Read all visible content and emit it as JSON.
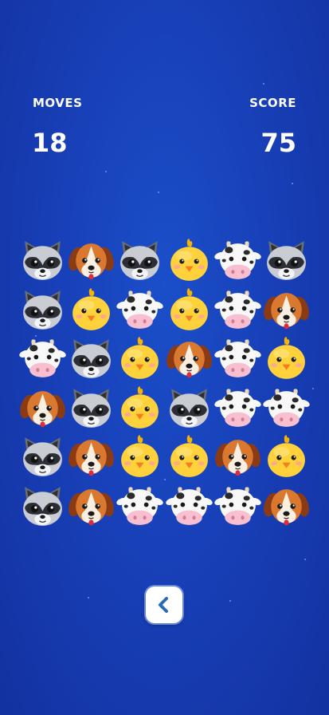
{
  "hud": {
    "moves_label": "MOVES",
    "moves_value": "18",
    "score_label": "SCORE",
    "score_value": "75"
  },
  "board": {
    "rows": 6,
    "cols": 6,
    "grid": [
      [
        "raccoon",
        "dog",
        "raccoon",
        "chick",
        "cow",
        "raccoon"
      ],
      [
        "raccoon",
        "chick",
        "cow",
        "chick",
        "cow",
        "dog"
      ],
      [
        "cow",
        "raccoon",
        "chick",
        "dog",
        "cow",
        "chick"
      ],
      [
        "dog",
        "raccoon",
        "chick",
        "raccoon",
        "cow",
        "cow"
      ],
      [
        "raccoon",
        "dog",
        "chick",
        "chick",
        "dog",
        "chick"
      ],
      [
        "raccoon",
        "dog",
        "cow",
        "cow",
        "cow",
        "dog"
      ]
    ]
  },
  "controls": {
    "back_icon": "chevron-left-icon"
  },
  "colors": {
    "background": "#1840b8",
    "chevron": "#2a6bb8",
    "button_border": "#aac8ff"
  }
}
